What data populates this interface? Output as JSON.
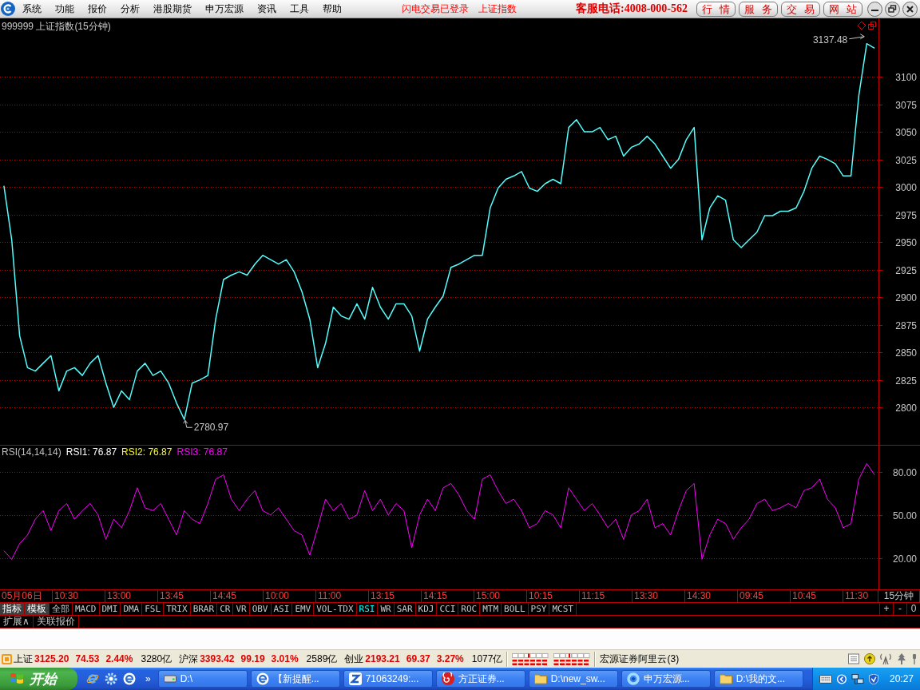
{
  "menu_bar": {
    "items": [
      "系统",
      "功能",
      "报价",
      "分析",
      "港股期货",
      "申万宏源",
      "资讯",
      "工具",
      "帮助"
    ],
    "notices": [
      "闪电交易已登录",
      "上证指数"
    ],
    "hotline": "客服电话:4008-000-562",
    "buttons": [
      "行 情",
      "服 务",
      "交 易",
      "网 站"
    ]
  },
  "main_chart": {
    "high_label": "3137.48",
    "low_label": "2780.97",
    "chart_data": {
      "type": "line",
      "title": "999999 上证指数(15分钟)",
      "grid": true,
      "ylim": [
        2766,
        3153
      ],
      "yticks": [
        2800,
        2825,
        2850,
        2875,
        2900,
        2925,
        2950,
        2975,
        3000,
        3025,
        3050,
        3075,
        3100
      ],
      "values": [
        3001,
        2952,
        2865,
        2836,
        2833,
        2840,
        2847,
        2815,
        2833,
        2836,
        2829,
        2840,
        2847,
        2822,
        2800,
        2815,
        2807,
        2833,
        2840,
        2829,
        2833,
        2822,
        2804,
        2789,
        2822,
        2825,
        2829,
        2880,
        2916,
        2920,
        2923,
        2920,
        2930,
        2938,
        2934,
        2930,
        2934,
        2923,
        2905,
        2880,
        2836,
        2858,
        2891,
        2883,
        2880,
        2894,
        2880,
        2909,
        2891,
        2880,
        2894,
        2894,
        2883,
        2851,
        2880,
        2891,
        2901,
        2927,
        2930,
        2934,
        2938,
        2938,
        2981,
        2999,
        3007,
        3010,
        3014,
        2999,
        2996,
        3003,
        3007,
        3003,
        3054,
        3061,
        3050,
        3050,
        3054,
        3043,
        3046,
        3028,
        3036,
        3039,
        3046,
        3039,
        3028,
        3017,
        3025,
        3043,
        3054,
        2952,
        2981,
        2992,
        2988,
        2952,
        2945,
        2952,
        2959,
        2974,
        2974,
        2978,
        2978,
        2981,
        2996,
        3017,
        3028,
        3025,
        3021,
        3010,
        3010,
        3083,
        3130,
        3126
      ]
    }
  },
  "rsi_panel": {
    "legend": [
      {
        "label": "RSI1: 76.87",
        "color": "#ffffff"
      },
      {
        "label": "RSI2: 76.87",
        "color": "#ffff00"
      },
      {
        "label": "RSI3: 76.87",
        "color": "#ff00ff"
      }
    ],
    "chart_data": {
      "type": "line",
      "title": "RSI(14,14,14)",
      "grid": true,
      "ylim": [
        -2,
        99
      ],
      "yticks": [
        {
          "value": 20,
          "label": "20.00"
        },
        {
          "value": 50,
          "label": "50.00"
        },
        {
          "value": 80,
          "label": "80.00"
        }
      ],
      "series": [
        {
          "color": "#ff00ff",
          "values": [
            25,
            19,
            30,
            36,
            47,
            53,
            39,
            53,
            58,
            47,
            53,
            58,
            50,
            33,
            47,
            41,
            53,
            69,
            55,
            53,
            58,
            47,
            36,
            53,
            47,
            44,
            58,
            75,
            78,
            61,
            53,
            61,
            67,
            53,
            50,
            55,
            47,
            39,
            36,
            22,
            41,
            61,
            53,
            58,
            47,
            50,
            67,
            53,
            61,
            50,
            58,
            53,
            27,
            50,
            61,
            53,
            69,
            72,
            64,
            53,
            47,
            75,
            78,
            67,
            58,
            61,
            53,
            41,
            44,
            53,
            50,
            41,
            69,
            61,
            53,
            58,
            50,
            41,
            47,
            33,
            50,
            53,
            61,
            41,
            44,
            36,
            53,
            67,
            72,
            19,
            36,
            47,
            44,
            33,
            41,
            47,
            58,
            61,
            53,
            55,
            58,
            55,
            67,
            69,
            75,
            61,
            55,
            41,
            44,
            75,
            86,
            78
          ]
        }
      ]
    }
  },
  "time_axis": {
    "labels": [
      "05月06日",
      "10:30",
      "13:00",
      "13:45",
      "14:45",
      "10:00",
      "11:00",
      "13:15",
      "14:15",
      "15:00",
      "10:15",
      "11:15",
      "13:30",
      "14:30",
      "09:45",
      "10:45",
      "11:30"
    ],
    "period": "15分钟"
  },
  "indicator_tabs": [
    {
      "label": "指标",
      "kind": "mode",
      "selected": false
    },
    {
      "label": "模板",
      "kind": "mode",
      "selected": false
    },
    {
      "label": "全部",
      "kind": "indicator",
      "selected": false
    },
    {
      "label": "MACD",
      "kind": "indicator",
      "selected": false
    },
    {
      "label": "DMI",
      "kind": "indicator",
      "selected": false
    },
    {
      "label": "DMA",
      "kind": "indicator",
      "selected": false
    },
    {
      "label": "FSL",
      "kind": "indicator",
      "selected": false
    },
    {
      "label": "TRIX",
      "kind": "indicator",
      "selected": false
    },
    {
      "label": "BRAR",
      "kind": "indicator",
      "selected": false
    },
    {
      "label": "CR",
      "kind": "indicator",
      "selected": false
    },
    {
      "label": "VR",
      "kind": "indicator",
      "selected": false
    },
    {
      "label": "OBV",
      "kind": "indicator",
      "selected": false
    },
    {
      "label": "ASI",
      "kind": "indicator",
      "selected": false
    },
    {
      "label": "EMV",
      "kind": "indicator",
      "selected": false
    },
    {
      "label": "VOL-TDX",
      "kind": "indicator",
      "selected": false
    },
    {
      "label": "RSI",
      "kind": "indicator",
      "selected": true
    },
    {
      "label": "WR",
      "kind": "indicator",
      "selected": false
    },
    {
      "label": "SAR",
      "kind": "indicator",
      "selected": false
    },
    {
      "label": "KDJ",
      "kind": "indicator",
      "selected": false
    },
    {
      "label": "CCI",
      "kind": "indicator",
      "selected": false
    },
    {
      "label": "ROC",
      "kind": "indicator",
      "selected": false
    },
    {
      "label": "MTM",
      "kind": "indicator",
      "selected": false
    },
    {
      "label": "BOLL",
      "kind": "indicator",
      "selected": false
    },
    {
      "label": "PSY",
      "kind": "indicator",
      "selected": false
    },
    {
      "label": "MCST",
      "kind": "indicator",
      "selected": false
    }
  ],
  "zoom_buttons": [
    "+",
    "-",
    "0"
  ],
  "extra_tabs": [
    "扩展∧",
    "关联报价"
  ],
  "status_bar": {
    "indices": [
      {
        "name": "上证",
        "price": "3125.20",
        "change": "74.53",
        "percent": "2.44%",
        "volume": "3280亿"
      },
      {
        "name": "沪深",
        "price": "3393.42",
        "change": "99.19",
        "percent": "3.01%",
        "volume": "2589亿"
      },
      {
        "name": "创业",
        "price": "2193.21",
        "change": "69.37",
        "percent": "3.27%",
        "volume": "1077亿"
      }
    ],
    "server": "宏源证券阿里云(3)"
  },
  "taskbar": {
    "start": "开始",
    "more": "»",
    "tasks": [
      {
        "label": "D:\\",
        "kind": "drive"
      },
      {
        "label": "【新提醒...",
        "kind": "browser"
      },
      {
        "label": "71063249:...",
        "kind": "messenger"
      },
      {
        "label": "方正证券...",
        "kind": "broker"
      },
      {
        "label": "D:\\new_sw...",
        "kind": "folder"
      },
      {
        "label": "申万宏源...",
        "kind": "trader"
      },
      {
        "label": "D:\\我的文...",
        "kind": "folder"
      }
    ],
    "clock": "20:27"
  }
}
